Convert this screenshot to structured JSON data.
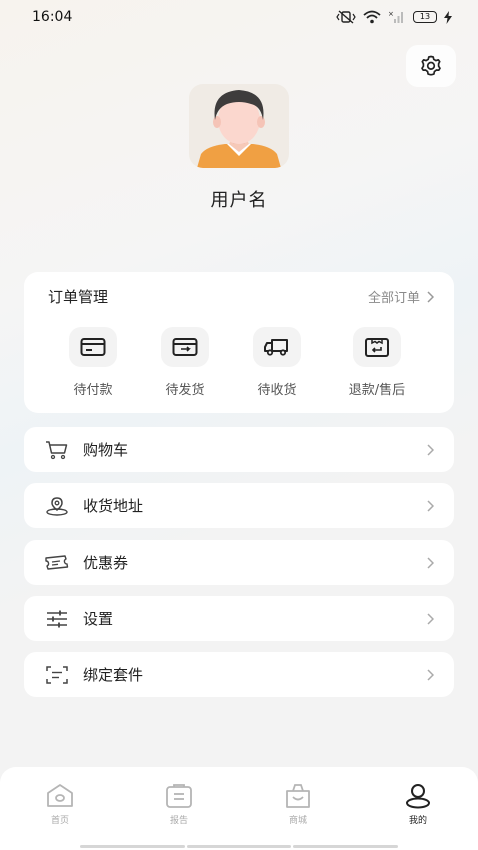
{
  "status_bar": {
    "time": "16:04",
    "battery": "13"
  },
  "profile": {
    "username": "用户名"
  },
  "orders": {
    "title": "订单管理",
    "all_label": "全部订单",
    "items": [
      {
        "label": "待付款",
        "icon": "wallet-card-icon"
      },
      {
        "label": "待发货",
        "icon": "package-box-icon"
      },
      {
        "label": "待收货",
        "icon": "delivery-truck-icon"
      },
      {
        "label": "退款/售后",
        "icon": "return-box-icon"
      }
    ]
  },
  "menu": [
    {
      "label": "购物车",
      "icon": "shopping-cart-icon"
    },
    {
      "label": "收货地址",
      "icon": "location-pin-icon"
    },
    {
      "label": "优惠券",
      "icon": "coupon-ticket-icon"
    },
    {
      "label": "设置",
      "icon": "sliders-icon"
    },
    {
      "label": "绑定套件",
      "icon": "scan-frame-icon"
    }
  ],
  "tab_bar": [
    {
      "label": "首页",
      "icon": "home-icon",
      "active": false
    },
    {
      "label": "报告",
      "icon": "report-icon",
      "active": false
    },
    {
      "label": "商城",
      "icon": "shopping-bag-icon",
      "active": false
    },
    {
      "label": "我的",
      "icon": "profile-icon",
      "active": true
    }
  ],
  "colors": {
    "accent_avatar_shirt": "#f0a043",
    "active_tab": "#222222",
    "inactive_tab": "#aaaaaa"
  }
}
